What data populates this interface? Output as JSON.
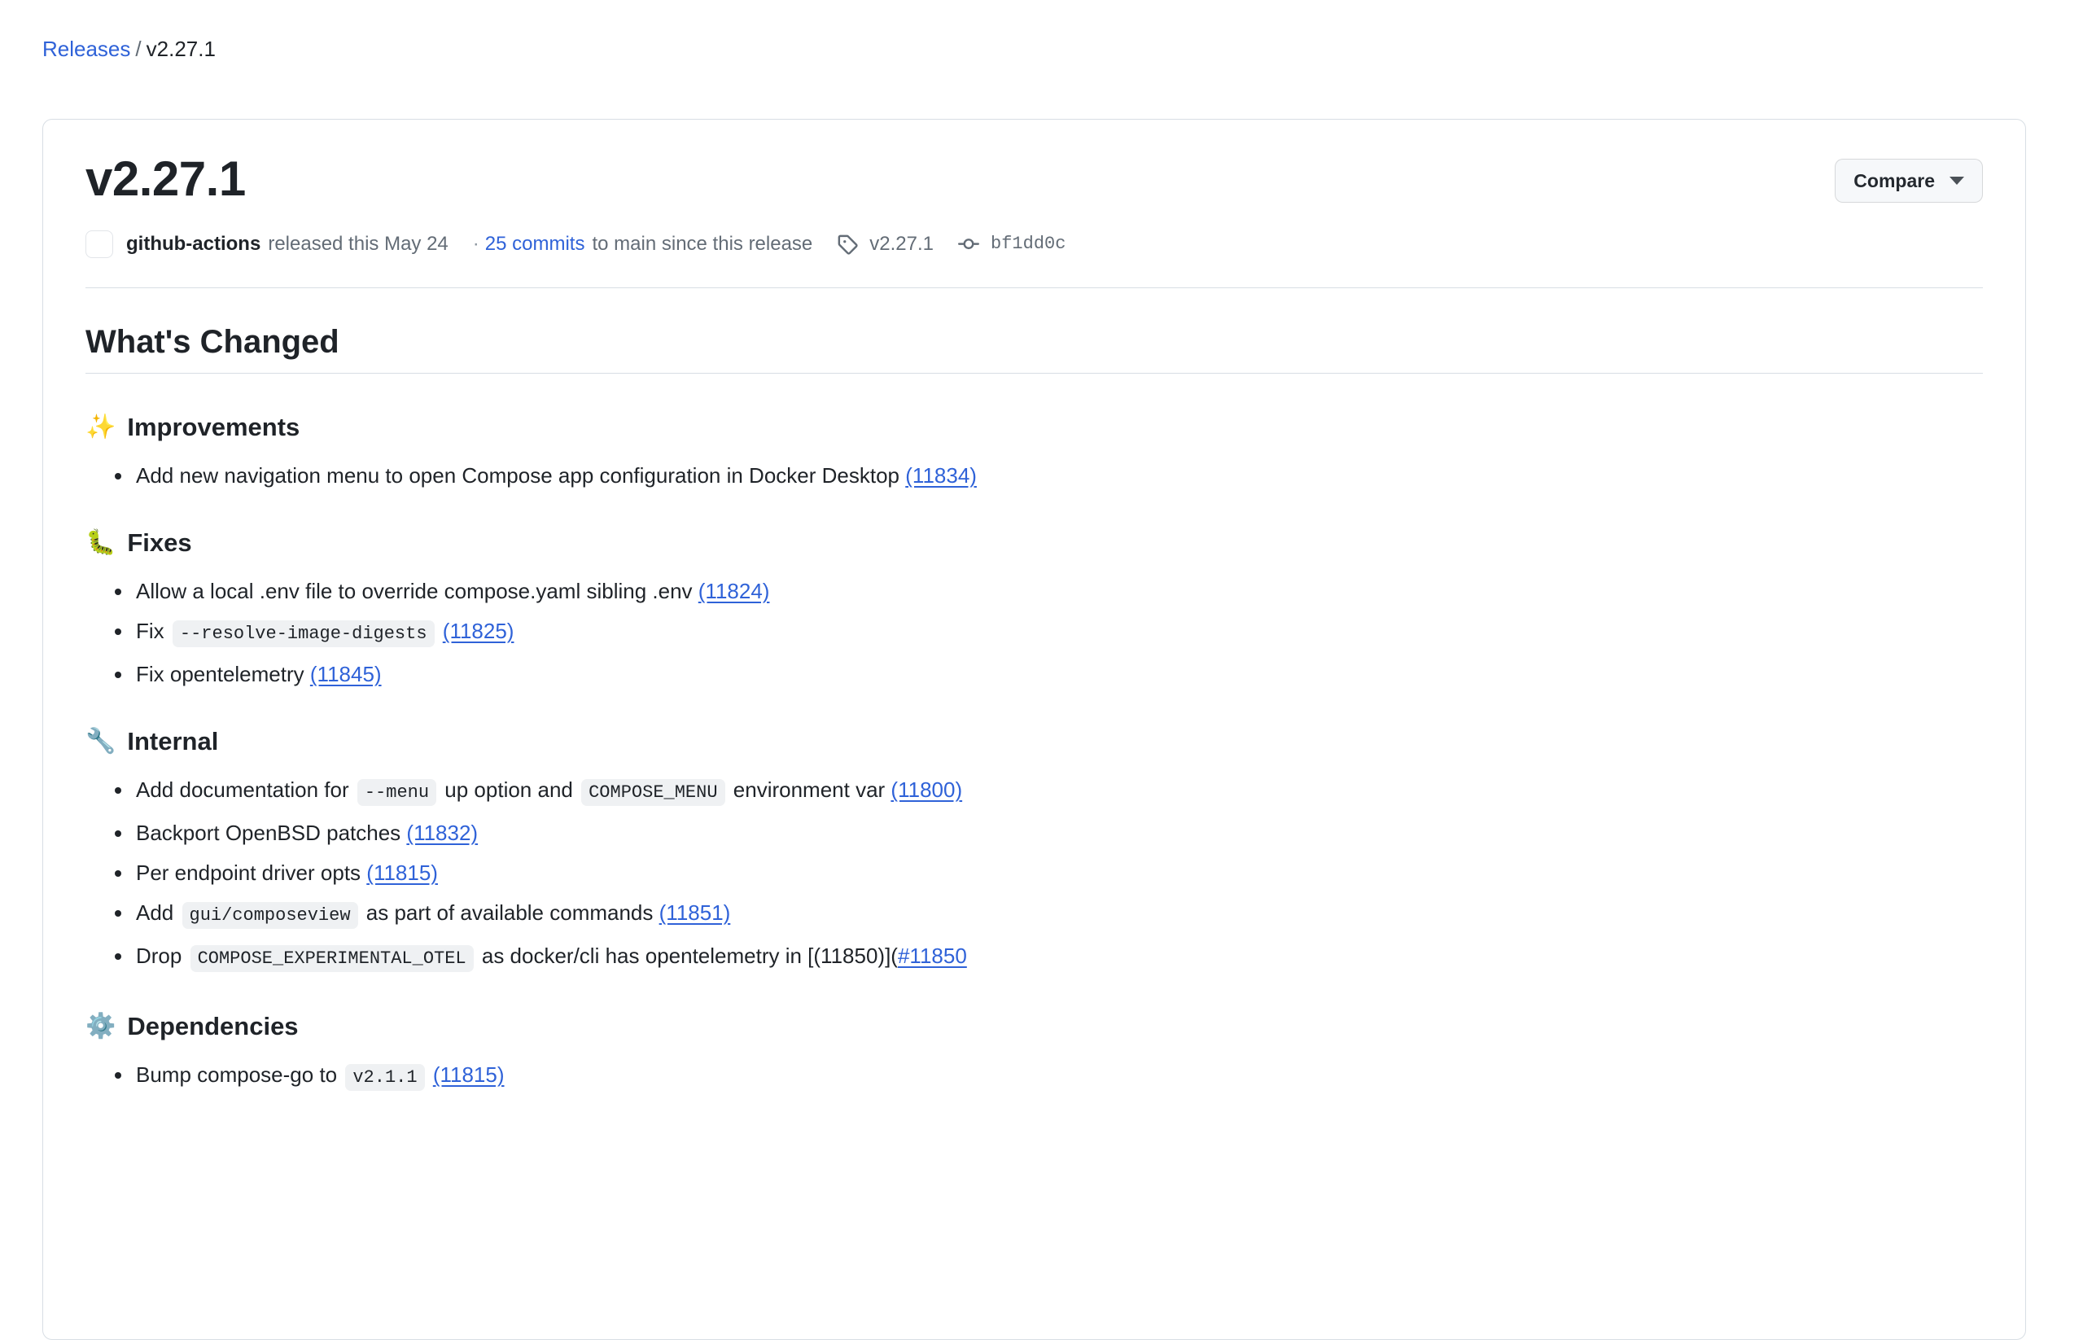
{
  "breadcrumb": {
    "parent_label": "Releases",
    "separator": "/",
    "current_label": "v2.27.1"
  },
  "release": {
    "title": "v2.27.1",
    "compare_label": "Compare",
    "meta": {
      "author": "github-actions",
      "released_text": "released this May 24",
      "dot": "·",
      "commits_link": "25 commits",
      "commits_suffix": "to main since this release",
      "tag_name": "v2.27.1",
      "commit_sha": "bf1dd0c",
      "tag_icon": "tag-icon",
      "commit_icon": "commit-icon",
      "avatar_icon": "avatar-placeholder"
    }
  },
  "body": {
    "heading": "What's Changed",
    "sections": [
      {
        "emoji": "✨",
        "emoji_name": "sparkles-emoji",
        "title": "Improvements",
        "items": [
          {
            "parts": [
              {
                "type": "text",
                "value": "Add new navigation menu to open Compose app configuration in Docker Desktop "
              },
              {
                "type": "link",
                "value": "(11834)"
              }
            ]
          }
        ]
      },
      {
        "emoji": "🐛",
        "emoji_name": "bug-emoji",
        "title": "Fixes",
        "items": [
          {
            "parts": [
              {
                "type": "text",
                "value": "Allow a local .env file to override compose.yaml sibling .env "
              },
              {
                "type": "link",
                "value": "(11824)"
              }
            ]
          },
          {
            "parts": [
              {
                "type": "text",
                "value": "Fix "
              },
              {
                "type": "code",
                "value": "--resolve-image-digests"
              },
              {
                "type": "text",
                "value": " "
              },
              {
                "type": "link",
                "value": "(11825)"
              }
            ]
          },
          {
            "parts": [
              {
                "type": "text",
                "value": "Fix opentelemetry "
              },
              {
                "type": "link",
                "value": "(11845)"
              }
            ]
          }
        ]
      },
      {
        "emoji": "🔧",
        "emoji_name": "wrench-emoji",
        "title": "Internal",
        "items": [
          {
            "parts": [
              {
                "type": "text",
                "value": "Add documentation for "
              },
              {
                "type": "code",
                "value": "--menu"
              },
              {
                "type": "text",
                "value": " up option and "
              },
              {
                "type": "code",
                "value": "COMPOSE_MENU"
              },
              {
                "type": "text",
                "value": " environment var "
              },
              {
                "type": "link",
                "value": "(11800)"
              }
            ]
          },
          {
            "parts": [
              {
                "type": "text",
                "value": "Backport OpenBSD patches "
              },
              {
                "type": "link",
                "value": "(11832)"
              }
            ]
          },
          {
            "parts": [
              {
                "type": "text",
                "value": "Per endpoint driver opts "
              },
              {
                "type": "link",
                "value": "(11815)"
              }
            ]
          },
          {
            "parts": [
              {
                "type": "text",
                "value": "Add "
              },
              {
                "type": "code",
                "value": "gui/composeview"
              },
              {
                "type": "text",
                "value": " as part of available commands "
              },
              {
                "type": "link",
                "value": "(11851)"
              }
            ]
          },
          {
            "parts": [
              {
                "type": "text",
                "value": "Drop "
              },
              {
                "type": "code",
                "value": "COMPOSE_EXPERIMENTAL_OTEL"
              },
              {
                "type": "text",
                "value": " as docker/cli has opentelemetry in [(11850)]("
              },
              {
                "type": "link",
                "value": "#11850"
              }
            ]
          }
        ]
      },
      {
        "emoji": "⚙️",
        "emoji_name": "gear-emoji",
        "title": "Dependencies",
        "items": [
          {
            "parts": [
              {
                "type": "text",
                "value": "Bump compose-go to "
              },
              {
                "type": "code",
                "value": "v2.1.1"
              },
              {
                "type": "text",
                "value": " "
              },
              {
                "type": "link",
                "value": "(11815)"
              }
            ]
          }
        ]
      }
    ]
  },
  "colors": {
    "link": "#2f62d8",
    "text": "#1f2328",
    "muted": "#636c76",
    "border": "#d8dee4",
    "code_bg": "#eff1f3",
    "button_bg": "#f6f8fa"
  }
}
